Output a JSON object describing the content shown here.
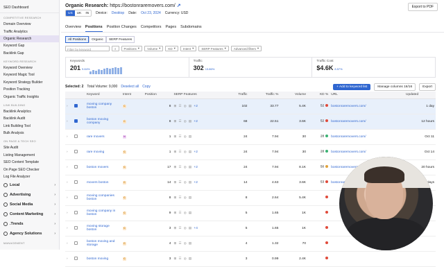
{
  "sidebar": {
    "top": "SEO Dashboard",
    "sections": [
      {
        "title": "COMPETITIVE RESEARCH",
        "items": [
          "Domain Overview",
          "Traffic Analytics",
          "Organic Research",
          "Keyword Gap",
          "Backlink Gap"
        ]
      },
      {
        "title": "KEYWORD RESEARCH",
        "items": [
          "Keyword Overview",
          "Keyword Magic Tool",
          "Keyword Strategy Builder",
          "Position Tracking",
          "Organic Traffic Insights"
        ]
      },
      {
        "title": "LINK BUILDING",
        "items": [
          "Backlink Analytics",
          "Backlink Audit",
          "Link Building Tool",
          "Bulk Analysis"
        ]
      },
      {
        "title": "ON PAGE & TECH SEO",
        "items": [
          "Site Audit",
          "Listing Management",
          "SEO Content Template",
          "On Page SEO Checker",
          "Log File Analyzer"
        ]
      }
    ],
    "big": [
      "Local",
      "Advertising",
      "Social Media",
      "Content Marketing",
      ".Trends",
      "Agency Solutions"
    ],
    "bottom": "MANAGEMENT"
  },
  "header": {
    "title": "Organic Research:",
    "domain": "https://bostonraremovers.com/",
    "export": "Export to PDF",
    "db": [
      "US",
      "UK",
      "IN"
    ],
    "device_label": "Device:",
    "device": "Desktop",
    "date_label": "Date:",
    "date": "Oct 23, 2024",
    "currency": "Currency: USD"
  },
  "tabs": [
    "Overview",
    "Positions",
    "Position Changes",
    "Competitors",
    "Pages",
    "Subdomains"
  ],
  "subtabs": [
    "All Positions",
    "Organic",
    "SERP Features"
  ],
  "filters": {
    "placeholder": "Filter by keyword",
    "buttons": [
      "Positions",
      "Volume",
      "KD",
      "Intent",
      "SERP Features",
      "Advanced filters"
    ]
  },
  "cards": [
    {
      "label": "Keywords",
      "value": "201",
      "change": "9.84%"
    },
    {
      "label": "Traffic",
      "value": "302",
      "change": "13.86%"
    },
    {
      "label": "Traffic Cost",
      "value": "$4.6K",
      "change": "8.57%"
    }
  ],
  "spark": [
    4,
    6,
    5,
    7,
    6,
    8,
    9,
    8,
    9,
    10,
    9,
    10
  ],
  "toolbar": {
    "selected": "Selected: 2",
    "total": "Total Volume: 9,000",
    "deselect": "Deselect all",
    "copy": "Copy",
    "add": "+ Add to keyword list",
    "manage": "Manage columns",
    "cols": "16/16",
    "export": "Export"
  },
  "columns": [
    "Keyword",
    "Intent",
    "Position",
    "SERP Features",
    "Traffic",
    "Traffic %",
    "Volume",
    "KD %",
    "URL",
    "Updated"
  ],
  "rows": [
    {
      "kw": "moving company boston",
      "intent": "C",
      "pos": "8",
      "serp": "+2",
      "traffic": "102",
      "tp": "33.77",
      "vol": "5.4K",
      "kd": "52",
      "kdc": "#e04a3a",
      "url": "bostonraremovers.com/",
      "upd": "1 day",
      "sel": true
    },
    {
      "kw": "boston moving company",
      "intent": "C",
      "pos": "8",
      "serp": "+2",
      "traffic": "68",
      "tp": "22.51",
      "vol": "3.6K",
      "kd": "52",
      "kdc": "#e04a3a",
      "url": "bostonraremovers.com/",
      "upd": "12 hours",
      "sel": true
    },
    {
      "kw": "rare movers",
      "intent": "N",
      "pos": "1",
      "serp": "",
      "traffic": "24",
      "tp": "7.94",
      "vol": "30",
      "kd": "28",
      "kdc": "#3bb273",
      "url": "bostonraremovers.com/",
      "upd": "Oct 11",
      "sel": false
    },
    {
      "kw": "rare moving",
      "intent": "C",
      "pos": "1",
      "serp": "+2",
      "traffic": "24",
      "tp": "7.94",
      "vol": "30",
      "kd": "28",
      "kdc": "#3bb273",
      "url": "bostonraremovers.com/",
      "upd": "Oct 14",
      "sel": false
    },
    {
      "kw": "boston movers",
      "intent": "C",
      "pos": "17",
      "serp": "+2",
      "traffic": "24",
      "tp": "7.94",
      "vol": "8.1K",
      "kd": "50",
      "kdc": "#e0a23a",
      "url": "bostonraremovers.com/",
      "upd": "20 hours",
      "sel": false
    },
    {
      "kw": "movers boston",
      "intent": "C",
      "pos": "14",
      "serp": "+2",
      "traffic": "14",
      "tp": "4.63",
      "vol": "3.6K",
      "kd": "53",
      "kdc": "#e04a3a",
      "url": "bostonraremovers.com/",
      "upd": "2 days",
      "sel": false
    },
    {
      "kw": "moving companies boston",
      "intent": "C",
      "pos": "8",
      "serp": "",
      "traffic": "8",
      "tp": "2.64",
      "vol": "5.4K",
      "kd": "",
      "kdc": "#e04a3a",
      "url": "",
      "upd": "",
      "sel": false
    },
    {
      "kw": "moving company in boston",
      "intent": "C",
      "pos": "9",
      "serp": "",
      "traffic": "5",
      "tp": "1.65",
      "vol": "1K",
      "kd": "",
      "kdc": "#e04a3a",
      "url": "",
      "upd": "",
      "sel": false
    },
    {
      "kw": "moving storage boston",
      "intent": "C",
      "pos": "3",
      "serp": "+4",
      "traffic": "5",
      "tp": "1.65",
      "vol": "1K",
      "kd": "",
      "kdc": "#e04a3a",
      "url": "",
      "upd": "",
      "sel": false
    },
    {
      "kw": "boston moving and storage",
      "intent": "C",
      "pos": "4",
      "serp": "",
      "traffic": "4",
      "tp": "1.32",
      "vol": "70",
      "kd": "",
      "kdc": "#e04a3a",
      "url": "",
      "upd": "",
      "sel": false
    },
    {
      "kw": "boston moving",
      "intent": "C",
      "pos": "3",
      "serp": "",
      "traffic": "3",
      "tp": "0.99",
      "vol": "2.4K",
      "kd": "",
      "kdc": "#e04a3a",
      "url": "",
      "upd": "",
      "sel": false
    }
  ]
}
